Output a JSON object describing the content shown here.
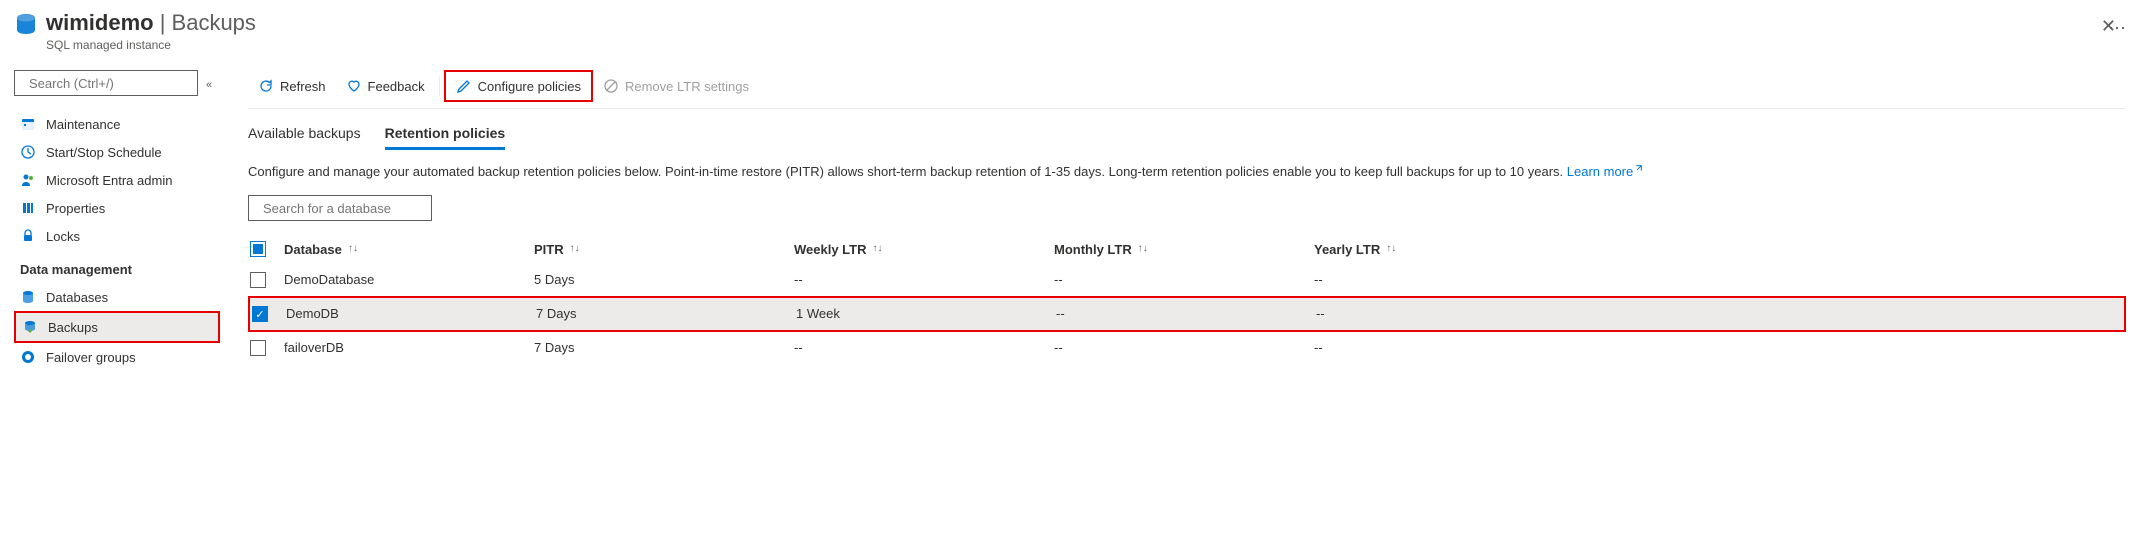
{
  "header": {
    "title": "wimidemo",
    "section": "Backups",
    "subtitle": "SQL managed instance"
  },
  "sidebar": {
    "search_placeholder": "Search (Ctrl+/)",
    "items": [
      {
        "label": "Maintenance",
        "icon": "calendar"
      },
      {
        "label": "Start/Stop Schedule",
        "icon": "clock"
      },
      {
        "label": "Microsoft Entra admin",
        "icon": "user-admin"
      },
      {
        "label": "Properties",
        "icon": "properties"
      },
      {
        "label": "Locks",
        "icon": "lock"
      }
    ],
    "section_label": "Data management",
    "data_items": [
      {
        "label": "Databases",
        "icon": "database"
      },
      {
        "label": "Backups",
        "icon": "backup",
        "active": true
      },
      {
        "label": "Failover groups",
        "icon": "failover"
      }
    ]
  },
  "toolbar": {
    "refresh": "Refresh",
    "feedback": "Feedback",
    "configure": "Configure policies",
    "remove": "Remove LTR settings"
  },
  "tabs": {
    "available": "Available backups",
    "retention": "Retention policies"
  },
  "description": {
    "text": "Configure and manage your automated backup retention policies below. Point-in-time restore (PITR) allows short-term backup retention of 1-35 days. Long-term retention policies enable you to keep full backups for up to 10 years. ",
    "learn_more": "Learn more"
  },
  "db_search_placeholder": "Search for a database",
  "columns": {
    "database": "Database",
    "pitr": "PITR",
    "weekly": "Weekly LTR",
    "monthly": "Monthly LTR",
    "yearly": "Yearly LTR"
  },
  "rows": [
    {
      "name": "DemoDatabase",
      "pitr": "5 Days",
      "weekly": "--",
      "monthly": "--",
      "yearly": "--",
      "checked": false
    },
    {
      "name": "DemoDB",
      "pitr": "7 Days",
      "weekly": "1 Week",
      "monthly": "--",
      "yearly": "--",
      "checked": true
    },
    {
      "name": "failoverDB",
      "pitr": "7 Days",
      "weekly": "--",
      "monthly": "--",
      "yearly": "--",
      "checked": false
    }
  ]
}
